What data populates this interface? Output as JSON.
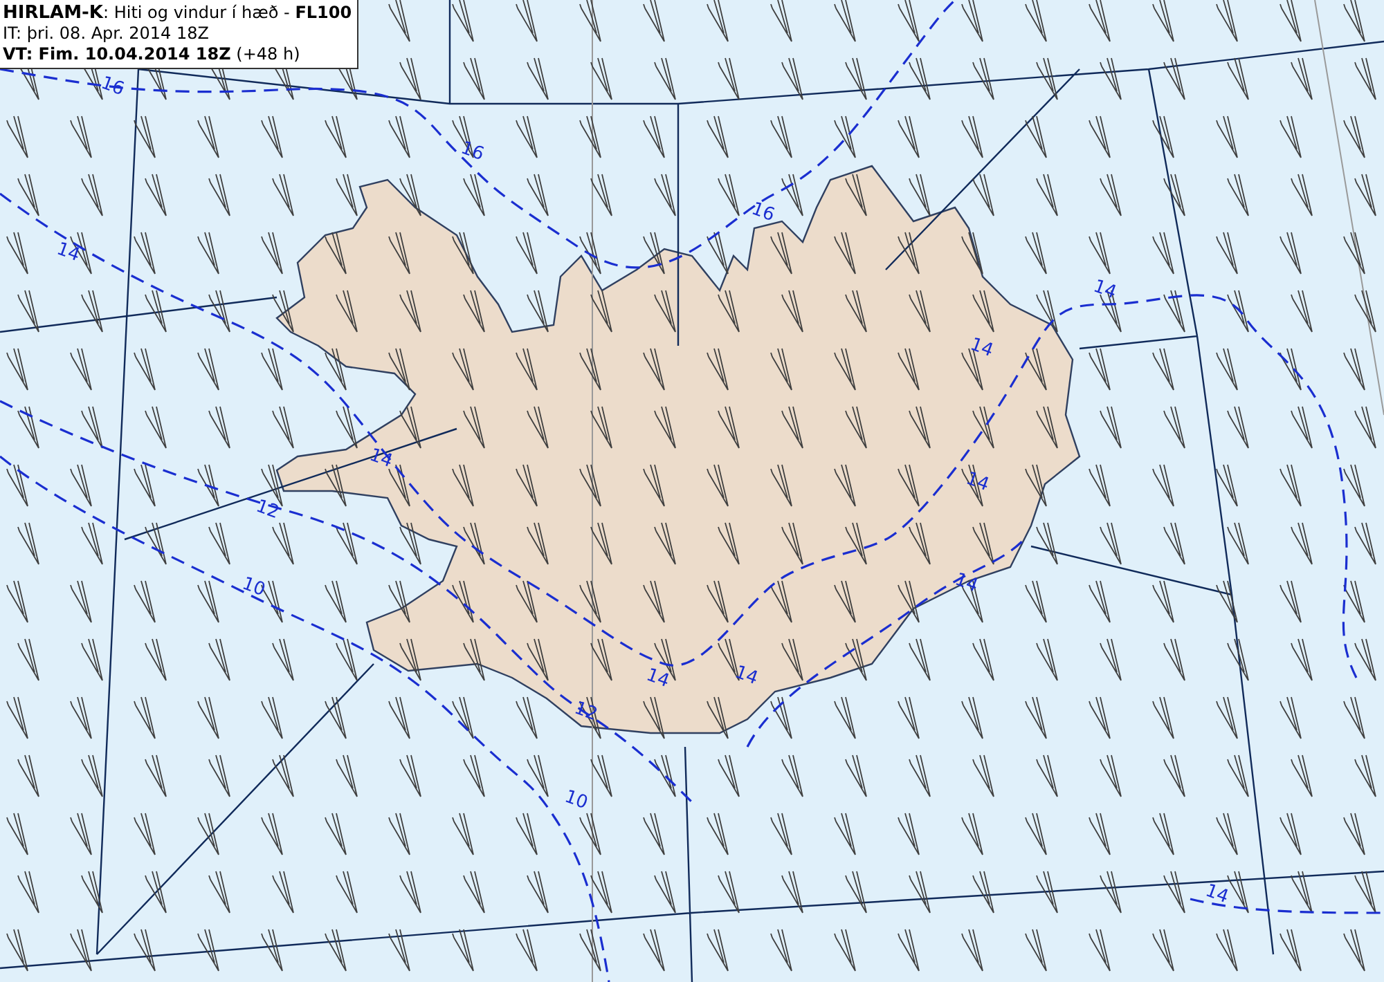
{
  "title_box": {
    "model": "HIRLAM-K",
    "description": ": Hiti og vindur í hæð - ",
    "level": "FL100",
    "issue_time": "IT: þri. 08. Apr. 2014 18Z",
    "valid_label": "VT: Fim. 10.04.2014 18Z",
    "valid_offset": " (+48 h)"
  },
  "contour_labels": [
    {
      "value": "16"
    },
    {
      "value": "16"
    },
    {
      "value": "16"
    },
    {
      "value": "14"
    },
    {
      "value": "14"
    },
    {
      "value": "14"
    },
    {
      "value": "14"
    },
    {
      "value": "14"
    },
    {
      "value": "14"
    },
    {
      "value": "14"
    },
    {
      "value": "14"
    },
    {
      "value": "14"
    },
    {
      "value": "12"
    },
    {
      "value": "12"
    },
    {
      "value": "10"
    },
    {
      "value": "10"
    }
  ]
}
